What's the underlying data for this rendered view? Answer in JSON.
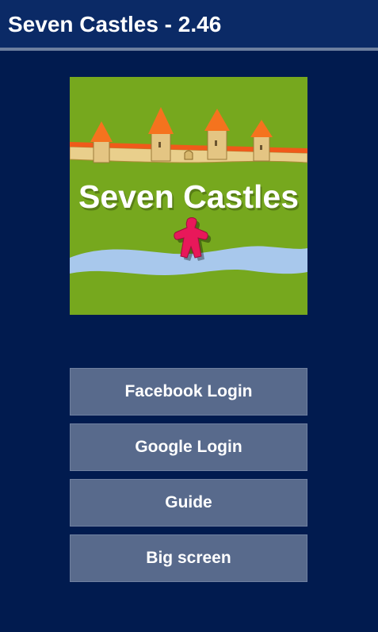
{
  "titlebar": {
    "title": "Seven Castles - 2.46"
  },
  "logo": {
    "text": "Seven Castles",
    "colors": {
      "grass": "#76a81e",
      "wall": "#e9cf8c",
      "roof": "#f56b1c",
      "river": "#a8c8ec",
      "meeple": "#e8185a"
    }
  },
  "menu": {
    "facebook_login": "Facebook Login",
    "google_login": "Google Login",
    "guide": "Guide",
    "big_screen": "Big screen"
  },
  "colors": {
    "background": "#011b4f",
    "titlebar": "#0b2a66",
    "button": "#586a8c"
  }
}
